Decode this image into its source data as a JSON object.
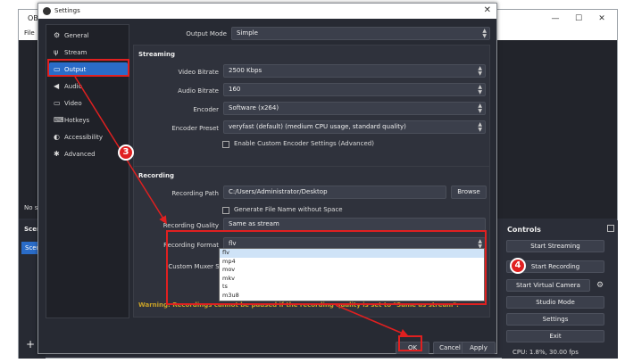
{
  "main_window": {
    "title": "OB",
    "menu_file": "File",
    "no_scene_text": "No sc",
    "scenes_title": "Scen",
    "scene_item": "Scen",
    "add_icon": "+",
    "controls": {
      "title": "Controls",
      "start_streaming": "Start Streaming",
      "start_recording": "Start Recording",
      "start_virtual_camera": "Start Virtual Camera",
      "studio_mode": "Studio Mode",
      "settings": "Settings",
      "exit": "Exit",
      "cpu": "CPU: 1.8%, 30.00 fps"
    },
    "win_min": "—",
    "win_max": "☐",
    "win_close": "✕"
  },
  "dialog": {
    "title": "Settings",
    "close": "✕",
    "sidebar": [
      {
        "label": "General",
        "icon": "⚙"
      },
      {
        "label": "Stream",
        "icon": "📡"
      },
      {
        "label": "Output",
        "icon": "▭"
      },
      {
        "label": "Audio",
        "icon": "🔊"
      },
      {
        "label": "Video",
        "icon": "▭"
      },
      {
        "label": "Hotkeys",
        "icon": "⌨"
      },
      {
        "label": "Accessibility",
        "icon": "◐"
      },
      {
        "label": "Advanced",
        "icon": "✱"
      }
    ],
    "output_mode": {
      "label": "Output Mode",
      "value": "Simple"
    },
    "streaming": {
      "title": "Streaming",
      "video_bitrate": {
        "label": "Video Bitrate",
        "value": "2500 Kbps"
      },
      "audio_bitrate": {
        "label": "Audio Bitrate",
        "value": "160"
      },
      "encoder": {
        "label": "Encoder",
        "value": "Software (x264)"
      },
      "encoder_preset": {
        "label": "Encoder Preset",
        "value": "veryfast (default) (medium CPU usage, standard quality)"
      },
      "custom_encoder": "Enable Custom Encoder Settings (Advanced)"
    },
    "recording": {
      "title": "Recording",
      "path": {
        "label": "Recording Path",
        "value": "C:/Users/Administrator/Desktop"
      },
      "browse": "Browse",
      "generate_name": "Generate File Name without Space",
      "quality": {
        "label": "Recording Quality",
        "value": "Same as stream"
      },
      "format": {
        "label": "Recording Format",
        "value": "flv"
      },
      "custom_muxer": "Custom Muxer Settings",
      "format_options": [
        "flv",
        "mp4",
        "mov",
        "mkv",
        "ts",
        "m3u8"
      ]
    },
    "warning": "Warning: Recordings cannot be paused if the recording quality is set to \"Same as stream\".",
    "ok": "OK",
    "cancel": "Cancel",
    "apply": "Apply"
  },
  "annotations": {
    "step3": "3",
    "step4": "4",
    "color": "#e02020"
  }
}
